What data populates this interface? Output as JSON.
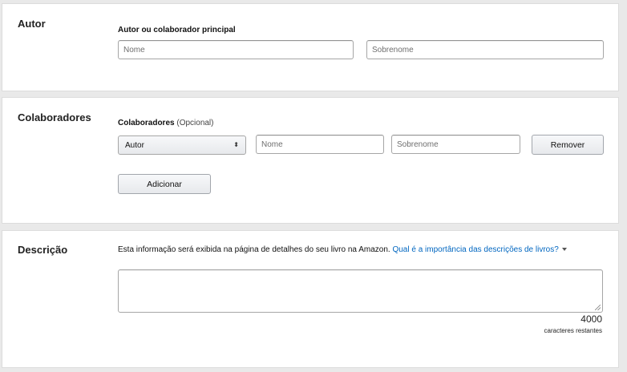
{
  "author": {
    "section_title": "Autor",
    "field_label": "Autor ou colaborador principal",
    "first_name_placeholder": "Nome",
    "last_name_placeholder": "Sobrenome"
  },
  "contributors": {
    "section_title": "Colaboradores",
    "field_label": "Colaboradores",
    "optional_label": "(Opcional)",
    "role_select_value": "Autor",
    "first_name_placeholder": "Nome",
    "last_name_placeholder": "Sobrenome",
    "remove_button": "Remover",
    "add_button": "Adicionar"
  },
  "description": {
    "section_title": "Descrição",
    "info_text": "Esta informação será exibida na página de detalhes do seu livro na Amazon.",
    "help_link": "Qual é a importância das descrições de livros?",
    "textarea_value": "",
    "char_count": "4000",
    "char_count_label": "caracteres restantes"
  }
}
